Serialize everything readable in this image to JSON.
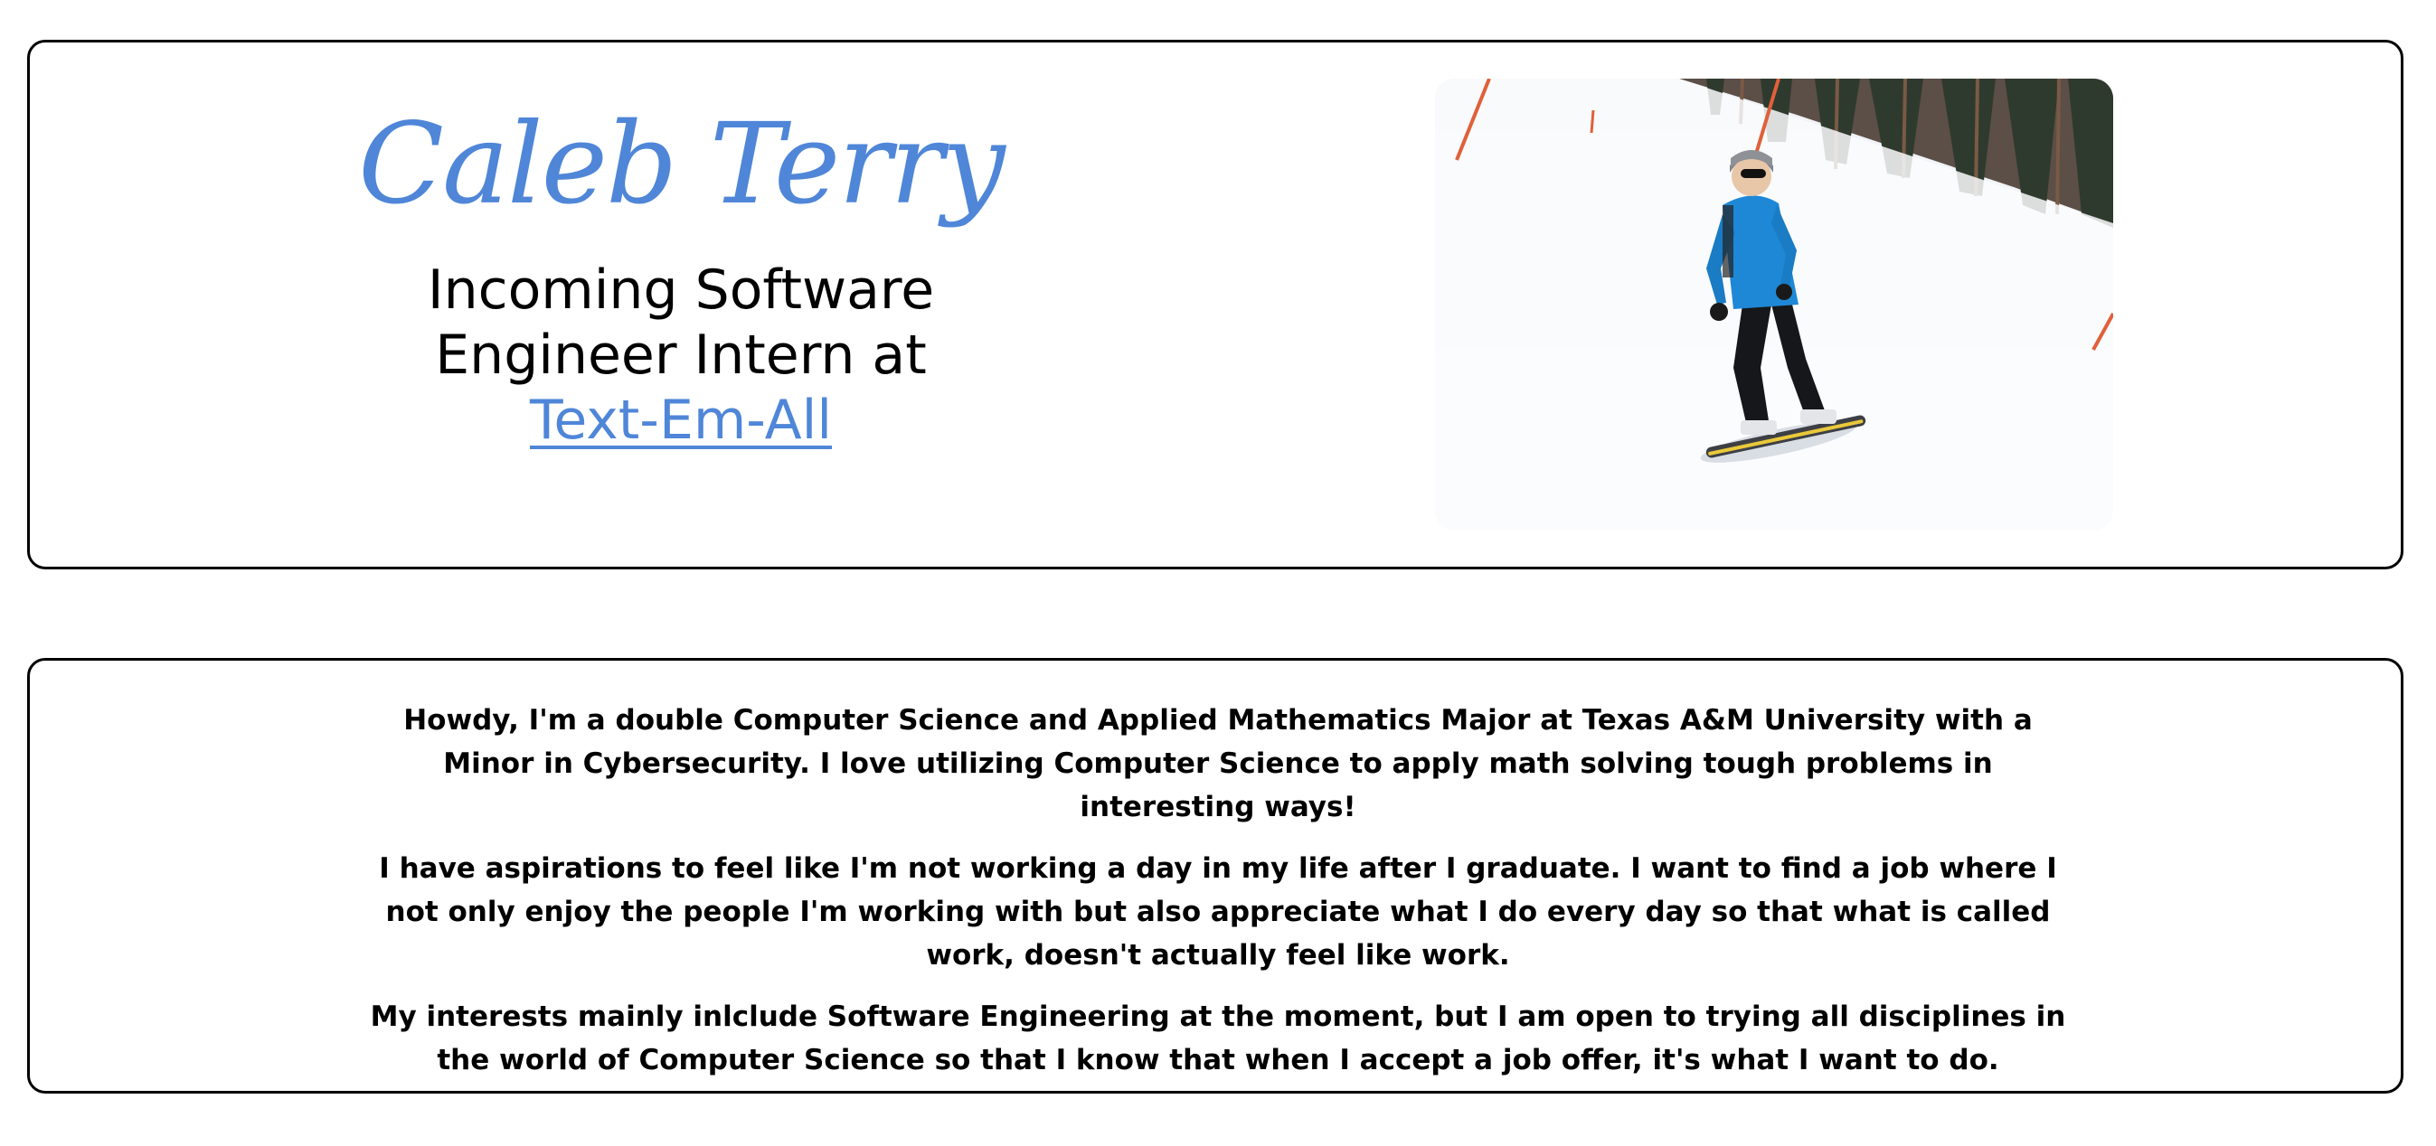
{
  "hero": {
    "name": "Caleb Terry",
    "role_line_1": "Incoming Software",
    "role_line_2": "Engineer Intern at",
    "company_link": "Text-Em-All",
    "photo_icon": "snowboarder-photo",
    "accent_color": "#4f86d8"
  },
  "about": {
    "paragraphs": [
      "Howdy, I'm a double Computer Science and Applied Mathematics Major at Texas A&M University with a Minor in Cybersecurity. I love utilizing Computer Science to apply math solving tough problems in interesting ways!",
      "I have aspirations to feel like I'm not working a day in my life after I graduate. I want to find a job where I not only enjoy the people I'm working with but also appreciate what I do every day so that what is called work, doesn't actually feel like work.",
      "My interests mainly inlclude Software Engineering at the moment, but I am open to trying all disciplines in the world of Computer Science so that I know that when I accept a job offer, it's what I want to do."
    ]
  }
}
